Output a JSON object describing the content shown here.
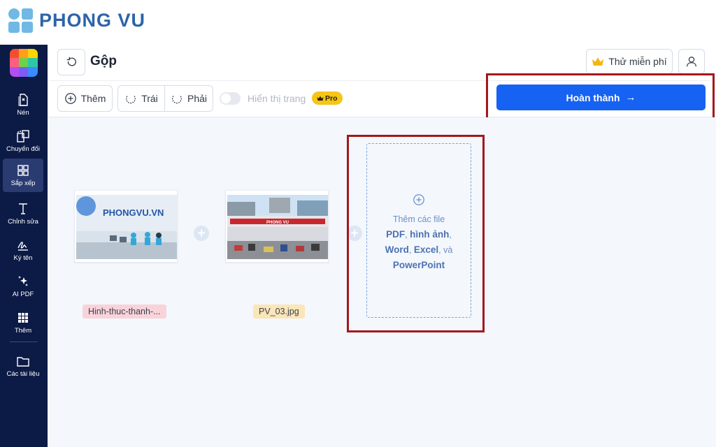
{
  "brand": {
    "name": "PHONG VU"
  },
  "sidebar": {
    "items": [
      {
        "label": "Nén",
        "icon": "compress-icon"
      },
      {
        "label": "Chuyển đổi",
        "icon": "convert-icon"
      },
      {
        "label": "Sắp xếp",
        "icon": "grid-icon",
        "active": true
      },
      {
        "label": "Chỉnh sửa",
        "icon": "text-edit-icon"
      },
      {
        "label": "Ký tên",
        "icon": "signature-icon"
      },
      {
        "label": "AI PDF",
        "icon": "sparkle-icon"
      },
      {
        "label": "Thêm",
        "icon": "apps-grid-icon"
      },
      {
        "label": "Các tài liệu",
        "icon": "folder-icon"
      }
    ]
  },
  "header": {
    "title": "Gộp",
    "trial_label": "Thử miễn phí"
  },
  "toolbar": {
    "add_label": "Thêm",
    "rotate_left_label": "Trái",
    "rotate_right_label": "Phải",
    "show_pages_label": "Hiển thị trang",
    "show_pages_enabled": false,
    "pro_label": "Pro",
    "finish_label": "Hoàn thành"
  },
  "files": [
    {
      "name": "Hinh-thuc-thanh-...",
      "tag_color": "#f9d3da",
      "thumb_logo_text": "PHONGVU.VN"
    },
    {
      "name": "PV_03.jpg",
      "tag_color": "#fbe6b8",
      "thumb_logo_text": "PHONG VU"
    }
  ],
  "dropzone": {
    "line1": "Thêm các file",
    "pdf": "PDF",
    "sep1": ",",
    "images": "hình ảnh",
    "sep2": ",",
    "word": "Word",
    "sep3": ",",
    "excel": "Excel",
    "and": ", và",
    "powerpoint": "PowerPoint"
  },
  "colors": {
    "sidebar_bg": "#0c1a46",
    "primary": "#1662f2",
    "highlight_border": "#a3181c",
    "pro_badge": "#f5c518"
  }
}
